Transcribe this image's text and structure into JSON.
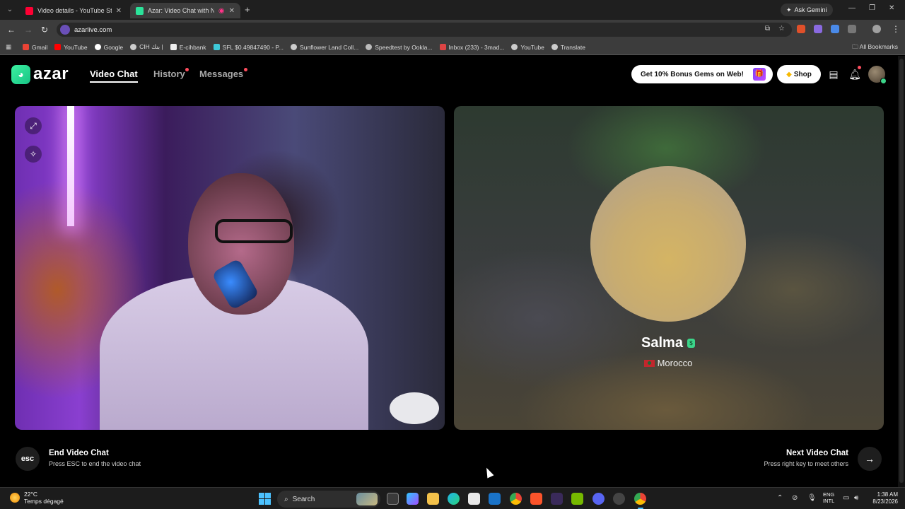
{
  "browser": {
    "tabs": [
      {
        "title": "Video details - YouTube Studio",
        "favicon": "youtube-studio-icon"
      },
      {
        "title": "Azar: Video Chat with New",
        "favicon": "azar-icon"
      }
    ],
    "ask_gemini": "Ask Gemini",
    "url": "azarlive.com",
    "bookmarks": [
      "Gmail",
      "YouTube",
      "Google",
      "CIH بنك |",
      "E-cihbank",
      "SFL $0.49847490 - P...",
      "Sunflower Land Coll...",
      "Speedtest by Ookla...",
      "Inbox (233) - 3mad...",
      "YouTube",
      "Translate"
    ],
    "all_bookmarks": "All Bookmarks"
  },
  "azar": {
    "logo_text": "azar",
    "nav": {
      "video_chat": "Video Chat",
      "history": "History",
      "messages": "Messages"
    },
    "bonus_label": "Get 10% Bonus Gems on Web!",
    "shop_label": "Shop",
    "peer": {
      "name": "Salma",
      "country": "Morocco"
    },
    "controls": {
      "esc_key": "esc",
      "end_title": "End Video Chat",
      "end_sub": "Press ESC to end the video chat",
      "next_title": "Next Video Chat",
      "next_sub": "Press right key to meet others"
    },
    "colors": {
      "brand": "#2be39a",
      "notification": "#ff4d5e",
      "verified": "#3cd58a"
    }
  },
  "taskbar": {
    "weather_temp": "22°C",
    "weather_desc": "Temps dégagé",
    "search_label": "Search",
    "lang_top": "ENG",
    "lang_bottom": "INTL",
    "time": "1:38 AM",
    "date": "8/23/2026"
  }
}
